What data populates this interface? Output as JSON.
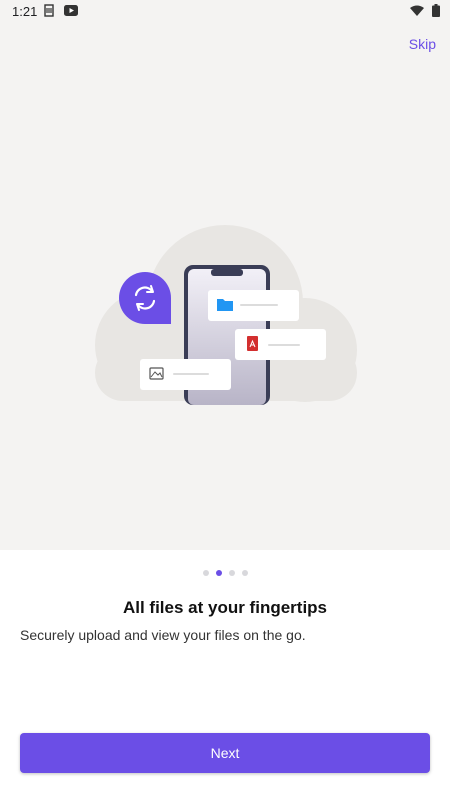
{
  "status_bar": {
    "time": "1:21",
    "left_icons": [
      "sim-icon",
      "youtube-icon"
    ],
    "right_icons": [
      "wifi-icon",
      "battery-icon"
    ]
  },
  "header": {
    "skip_label": "Skip"
  },
  "illustration": {
    "icons": [
      "sync-icon",
      "folder-icon",
      "pdf-icon",
      "image-icon",
      "phone-icon",
      "cloud-icon"
    ],
    "colors": {
      "accent": "#6b4ee6",
      "folder": "#2196f3",
      "pdf": "#d32f2f"
    }
  },
  "pager": {
    "total": 4,
    "active_index": 1
  },
  "content": {
    "title": "All files at your fingertips",
    "description": "Securely upload and view your files on the go."
  },
  "footer": {
    "next_label": "Next"
  },
  "colors": {
    "accent": "#6b4ee6",
    "background_top": "#f4f3f2",
    "background_bottom": "#ffffff"
  }
}
